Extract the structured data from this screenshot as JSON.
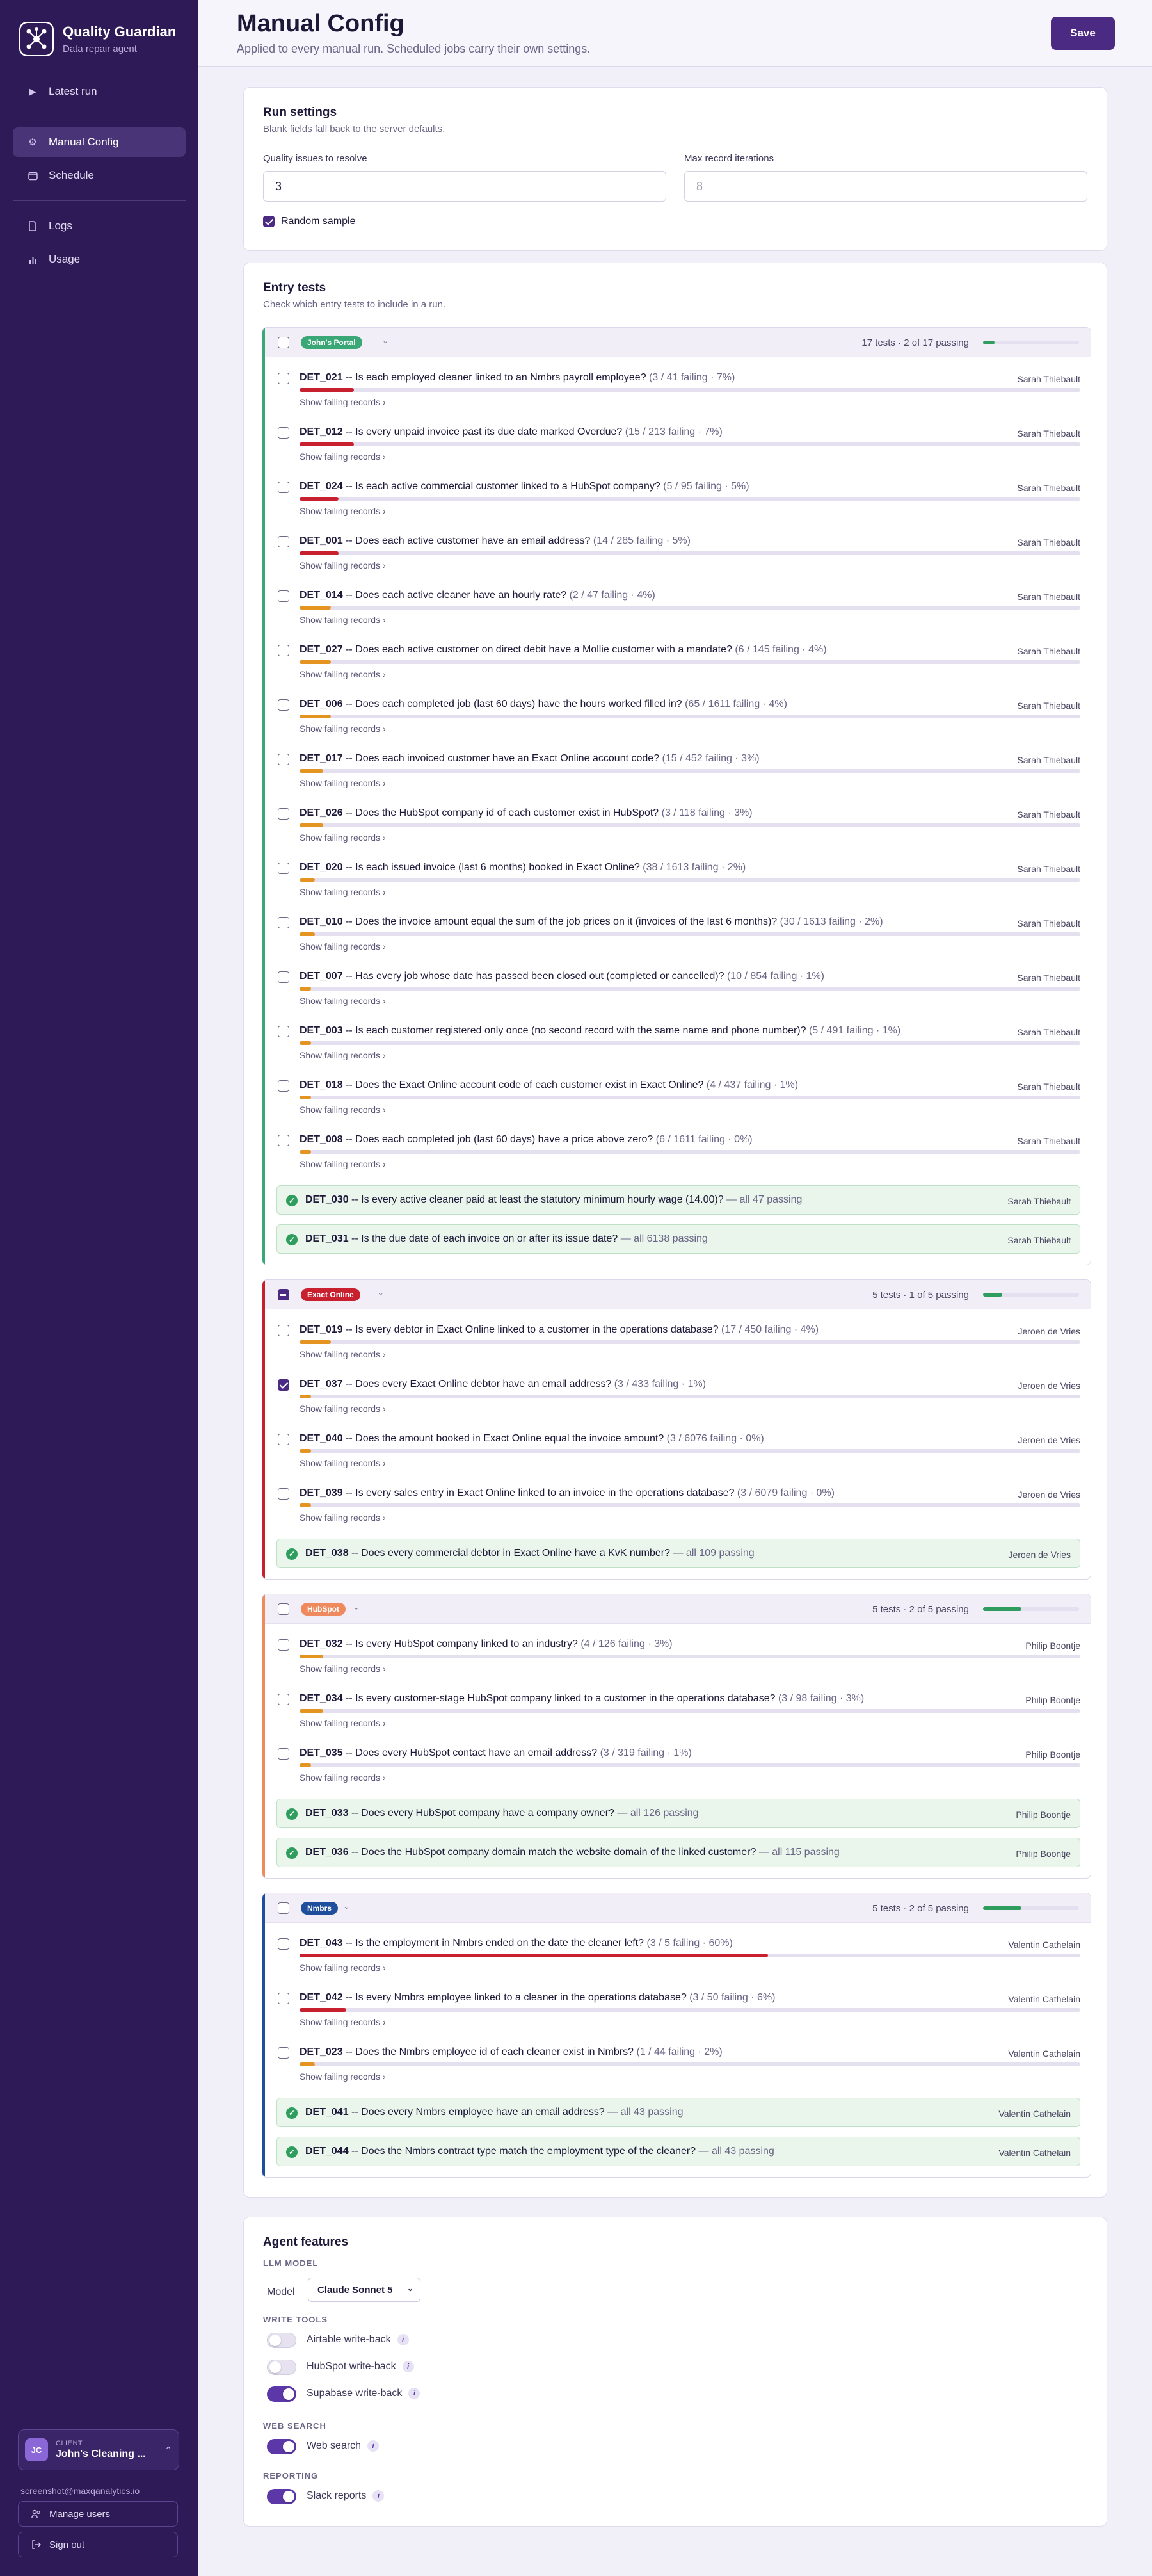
{
  "app": {
    "name": "Quality Guardian",
    "subtitle": "Data repair agent"
  },
  "nav": [
    {
      "label": "Latest run",
      "icon": "play-icon",
      "active": false
    },
    {
      "label": "Manual Config",
      "icon": "gear-icon",
      "active": true
    },
    {
      "label": "Schedule",
      "icon": "calendar-icon",
      "active": false
    },
    {
      "label": "Logs",
      "icon": "document-icon",
      "active": false
    },
    {
      "label": "Usage",
      "icon": "bar-chart-icon",
      "active": false
    }
  ],
  "client": {
    "label": "CLIENT",
    "name": "John's Cleaning ...",
    "initials": "JC"
  },
  "user_email": "screenshot@maxqanalytics.io",
  "side_buttons": {
    "manage": "Manage users",
    "signout": "Sign out"
  },
  "header": {
    "title": "Manual Config",
    "subtitle": "Applied to every manual run. Scheduled jobs carry their own settings.",
    "save": "Save"
  },
  "run_settings": {
    "title": "Run settings",
    "subtitle": "Blank fields fall back to the server defaults.",
    "quality_label": "Quality issues to resolve",
    "quality_value": "3",
    "max_label": "Max record iterations",
    "max_placeholder": "8",
    "random_label": "Random sample",
    "random_checked": true
  },
  "entry_tests": {
    "title": "Entry tests",
    "subtitle": "Check which entry tests to include in a run.",
    "show_link": "Show failing records",
    "groups": [
      {
        "name": "John's Portal",
        "color": "#3aa876",
        "summary": "17 tests · 2 of 17 passing",
        "progress": 0.12,
        "failing": [
          {
            "code": "DET_021",
            "question": " -- Is each employed cleaner linked to an Nmbrs payroll employee?",
            "meta": " (3 / 41 failing · 7%)",
            "owner": "Sarah Thiebault",
            "pct": 0.07,
            "checked": false
          },
          {
            "code": "DET_012",
            "question": " -- Is every unpaid invoice past its due date marked Overdue?",
            "meta": " (15 / 213 failing · 7%)",
            "owner": "Sarah Thiebault",
            "pct": 0.07,
            "checked": false
          },
          {
            "code": "DET_024",
            "question": " -- Is each active commercial customer linked to a HubSpot company?",
            "meta": " (5 / 95 failing · 5%)",
            "owner": "Sarah Thiebault",
            "pct": 0.05,
            "checked": false
          },
          {
            "code": "DET_001",
            "question": " -- Does each active customer have an email address?",
            "meta": " (14 / 285 failing · 5%)",
            "owner": "Sarah Thiebault",
            "pct": 0.05,
            "checked": false
          },
          {
            "code": "DET_014",
            "question": " -- Does each active cleaner have an hourly rate?",
            "meta": " (2 / 47 failing · 4%)",
            "owner": "Sarah Thiebault",
            "pct": 0.04,
            "checked": false
          },
          {
            "code": "DET_027",
            "question": " -- Does each active customer on direct debit have a Mollie customer with a mandate?",
            "meta": " (6 / 145 failing · 4%)",
            "owner": "Sarah Thiebault",
            "pct": 0.04,
            "checked": false
          },
          {
            "code": "DET_006",
            "question": " -- Does each completed job (last 60 days) have the hours worked filled in?",
            "meta": " (65 / 1611 failing · 4%)",
            "owner": "Sarah Thiebault",
            "pct": 0.04,
            "checked": false
          },
          {
            "code": "DET_017",
            "question": " -- Does each invoiced customer have an Exact Online account code?",
            "meta": " (15 / 452 failing · 3%)",
            "owner": "Sarah Thiebault",
            "pct": 0.03,
            "checked": false
          },
          {
            "code": "DET_026",
            "question": " -- Does the HubSpot company id of each customer exist in HubSpot?",
            "meta": " (3 / 118 failing · 3%)",
            "owner": "Sarah Thiebault",
            "pct": 0.03,
            "checked": false
          },
          {
            "code": "DET_020",
            "question": " -- Is each issued invoice (last 6 months) booked in Exact Online?",
            "meta": " (38 / 1613 failing · 2%)",
            "owner": "Sarah Thiebault",
            "pct": 0.02,
            "checked": false
          },
          {
            "code": "DET_010",
            "question": " -- Does the invoice amount equal the sum of the job prices on it (invoices of the last 6 months)?",
            "meta": " (30 / 1613 failing · 2%)",
            "owner": "Sarah Thiebault",
            "pct": 0.02,
            "checked": false
          },
          {
            "code": "DET_007",
            "question": " -- Has every job whose date has passed been closed out (completed or cancelled)?",
            "meta": " (10 / 854 failing · 1%)",
            "owner": "Sarah Thiebault",
            "pct": 0.01,
            "checked": false
          },
          {
            "code": "DET_003",
            "question": " -- Is each customer registered only once (no second record with the same name and phone number)?",
            "meta": " (5 / 491 failing · 1%)",
            "owner": "Sarah Thiebault",
            "pct": 0.01,
            "checked": false
          },
          {
            "code": "DET_018",
            "question": " -- Does the Exact Online account code of each customer exist in Exact Online?",
            "meta": " (4 / 437 failing · 1%)",
            "owner": "Sarah Thiebault",
            "pct": 0.01,
            "checked": false
          },
          {
            "code": "DET_008",
            "question": " -- Does each completed job (last 60 days) have a price above zero?",
            "meta": " (6 / 1611 failing · 0%)",
            "owner": "Sarah Thiebault",
            "pct": 0.004,
            "checked": false
          }
        ],
        "passing": [
          {
            "code": "DET_030",
            "question": " -- Is every active cleaner paid at least the statutory minimum hourly wage (14.00)?",
            "meta": " — all 47 passing",
            "owner": "Sarah Thiebault"
          },
          {
            "code": "DET_031",
            "question": " -- Is the due date of each invoice on or after its issue date?",
            "meta": " — all 6138 passing",
            "owner": "Sarah Thiebault"
          }
        ]
      },
      {
        "name": "Exact Online",
        "color": "#c8202f",
        "summary": "5 tests · 1 of 5 passing",
        "progress": 0.2,
        "indeterminate": true,
        "failing": [
          {
            "code": "DET_019",
            "question": " -- Is every debtor in Exact Online linked to a customer in the operations database?",
            "meta": " (17 / 450 failing · 4%)",
            "owner": "Jeroen de Vries",
            "pct": 0.04,
            "checked": false
          },
          {
            "code": "DET_037",
            "question": " -- Does every Exact Online debtor have an email address?",
            "meta": " (3 / 433 failing · 1%)",
            "owner": "Jeroen de Vries",
            "pct": 0.01,
            "checked": true
          },
          {
            "code": "DET_040",
            "question": " -- Does the amount booked in Exact Online equal the invoice amount?",
            "meta": " (3 / 6076 failing · 0%)",
            "owner": "Jeroen de Vries",
            "pct": 0.004,
            "checked": false
          },
          {
            "code": "DET_039",
            "question": " -- Is every sales entry in Exact Online linked to an invoice in the operations database?",
            "meta": " (3 / 6079 failing · 0%)",
            "owner": "Jeroen de Vries",
            "pct": 0.004,
            "checked": false
          }
        ],
        "passing": [
          {
            "code": "DET_038",
            "question": " -- Does every commercial debtor in Exact Online have a KvK number?",
            "meta": " — all 109 passing",
            "owner": "Jeroen de Vries"
          }
        ]
      },
      {
        "name": "HubSpot",
        "color": "#ee8a5e",
        "summary": "5 tests · 2 of 5 passing",
        "progress": 0.4,
        "failing": [
          {
            "code": "DET_032",
            "question": " -- Is every HubSpot company linked to an industry?",
            "meta": " (4 / 126 failing · 3%)",
            "owner": "Philip Boontje",
            "pct": 0.03,
            "checked": false
          },
          {
            "code": "DET_034",
            "question": " -- Is every customer-stage HubSpot company linked to a customer in the operations database?",
            "meta": " (3 / 98 failing · 3%)",
            "owner": "Philip Boontje",
            "pct": 0.03,
            "checked": false
          },
          {
            "code": "DET_035",
            "question": " -- Does every HubSpot contact have an email address?",
            "meta": " (3 / 319 failing · 1%)",
            "owner": "Philip Boontje",
            "pct": 0.01,
            "checked": false
          }
        ],
        "passing": [
          {
            "code": "DET_033",
            "question": " -- Does every HubSpot company have a company owner?",
            "meta": " — all 126 passing",
            "owner": "Philip Boontje"
          },
          {
            "code": "DET_036",
            "question": " -- Does the HubSpot company domain match the website domain of the linked customer?",
            "meta": " — all 115 passing",
            "owner": "Philip Boontje"
          }
        ]
      },
      {
        "name": "Nmbrs",
        "color": "#1f4f9c",
        "summary": "5 tests · 2 of 5 passing",
        "progress": 0.4,
        "failing": [
          {
            "code": "DET_043",
            "question": " -- Is the employment in Nmbrs ended on the date the cleaner left?",
            "meta": " (3 / 5 failing · 60%)",
            "owner": "Valentin Cathelain",
            "pct": 0.6,
            "checked": false
          },
          {
            "code": "DET_042",
            "question": " -- Is every Nmbrs employee linked to a cleaner in the operations database?",
            "meta": " (3 / 50 failing · 6%)",
            "owner": "Valentin Cathelain",
            "pct": 0.06,
            "checked": false
          },
          {
            "code": "DET_023",
            "question": " -- Does the Nmbrs employee id of each cleaner exist in Nmbrs?",
            "meta": " (1 / 44 failing · 2%)",
            "owner": "Valentin Cathelain",
            "pct": 0.02,
            "checked": false
          }
        ],
        "passing": [
          {
            "code": "DET_041",
            "question": " -- Does every Nmbrs employee have an email address?",
            "meta": " — all 43 passing",
            "owner": "Valentin Cathelain"
          },
          {
            "code": "DET_044",
            "question": " -- Does the Nmbrs contract type match the employment type of the cleaner?",
            "meta": " — all 43 passing",
            "owner": "Valentin Cathelain"
          }
        ]
      }
    ]
  },
  "agent": {
    "title": "Agent features",
    "llm_section": "LLM MODEL",
    "model_label": "Model",
    "model_value": "Claude Sonnet 5",
    "write_section": "WRITE TOOLS",
    "write_tools": [
      {
        "label": "Airtable write-back",
        "on": false
      },
      {
        "label": "HubSpot write-back",
        "on": false
      },
      {
        "label": "Supabase write-back",
        "on": true
      }
    ],
    "web_section": "WEB SEARCH",
    "web_label": "Web search",
    "web_on": true,
    "report_section": "REPORTING",
    "report_label": "Slack reports",
    "report_on": true
  },
  "colors": {
    "accent": "#4a2a82",
    "sidebar": "#2e1a57",
    "red": "#c8202f",
    "orange": "#e39421",
    "green": "#2e9d5e"
  }
}
